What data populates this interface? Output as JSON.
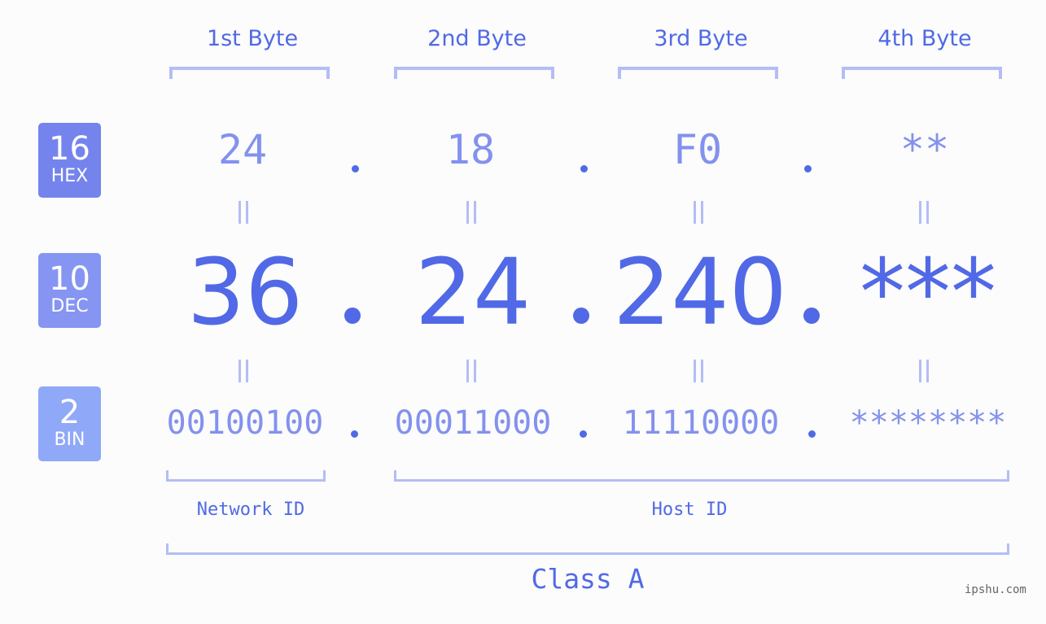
{
  "byte_headers": [
    "1st Byte",
    "2nd Byte",
    "3rd Byte",
    "4th Byte"
  ],
  "badges": [
    {
      "number": "16",
      "label": "HEX",
      "color": "#7584ec"
    },
    {
      "number": "10",
      "label": "DEC",
      "color": "#8695f1"
    },
    {
      "number": "2",
      "label": "BIN",
      "color": "#90a8f8"
    }
  ],
  "hex_values": [
    "24",
    "18",
    "F0",
    "**"
  ],
  "dec_values": [
    "36",
    "24",
    "240",
    "***"
  ],
  "bin_values": [
    "00100100",
    "00011000",
    "11110000",
    "********"
  ],
  "network_id_label": "Network ID",
  "host_id_label": "Host ID",
  "class_label": "Class A",
  "watermark": "ipshu.com",
  "colors": {
    "accent": "#5169e6",
    "light": "#8391ee",
    "bracket": "#b3bdf6"
  }
}
